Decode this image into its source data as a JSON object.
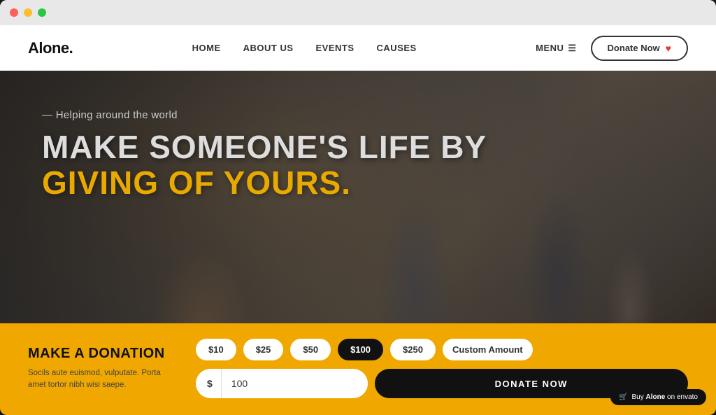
{
  "browser": {
    "dots": [
      "red",
      "yellow",
      "green"
    ]
  },
  "navbar": {
    "logo": "Alone.",
    "links": [
      {
        "label": "HOME",
        "id": "home"
      },
      {
        "label": "ABOUT US",
        "id": "about-us"
      },
      {
        "label": "EVENTS",
        "id": "events"
      },
      {
        "label": "CAUSES",
        "id": "causes"
      }
    ],
    "menu_label": "MENU",
    "donate_label": "Donate Now"
  },
  "hero": {
    "subtitle": "Helping around the world",
    "title_line1": "MAKE SOMEONE'S LIFE BY",
    "title_line2": "GIVING OF YOURS."
  },
  "donation": {
    "title": "MAKE A DONATION",
    "description": "Socils aute euismod, vulputate. Porta amet tortor nibh wisi saepe.",
    "amounts": [
      {
        "label": "$10",
        "value": "10",
        "active": false
      },
      {
        "label": "$25",
        "value": "25",
        "active": false
      },
      {
        "label": "$50",
        "value": "50",
        "active": false
      },
      {
        "label": "$100",
        "value": "100",
        "active": true
      },
      {
        "label": "$250",
        "value": "250",
        "active": false
      },
      {
        "label": "Custom Amount",
        "value": "custom",
        "active": false
      }
    ],
    "currency_symbol": "$",
    "input_value": "100",
    "donate_button_label": "DONATE NOW"
  },
  "envato": {
    "text": "Buy",
    "brand": "Alone",
    "suffix": "on envato"
  }
}
